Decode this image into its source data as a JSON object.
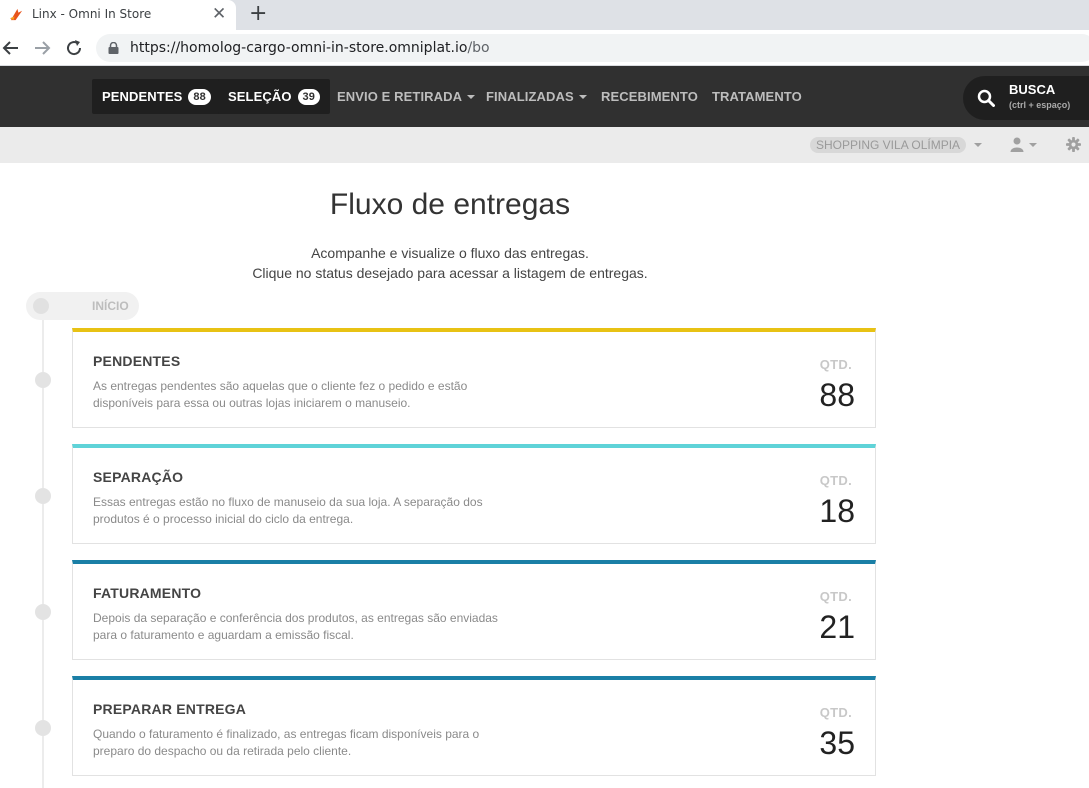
{
  "browser": {
    "tab_title": "Linx - Omni In Store",
    "tab_close": "✕",
    "new_tab": "+",
    "url_main": "https://homolog-cargo-omni-in-store.omniplat.io",
    "url_rest": "/bo"
  },
  "nav": {
    "items": [
      {
        "label": "PENDENTES",
        "badge": "88"
      },
      {
        "label": "SELEÇÃO",
        "badge": "39"
      },
      {
        "label": "ENVIO E RETIRADA"
      },
      {
        "label": "FINALIZADAS"
      },
      {
        "label": "RECEBIMENTO"
      },
      {
        "label": "TRATAMENTO"
      }
    ],
    "search_label": "BUSCA",
    "search_hint": "(ctrl + espaço)"
  },
  "subbar": {
    "store": "SHOPPING VILA OLÍMPIA"
  },
  "page": {
    "title": "Fluxo de entregas",
    "intro_line1": "Acompanhe e visualize o fluxo das entregas.",
    "intro_line2": "Clique no status desejado para acessar a listagem de entregas.",
    "start_label": "INÍCIO"
  },
  "cards": [
    {
      "title": "PENDENTES",
      "desc": "As entregas pendentes são aquelas que o cliente fez o pedido e estão disponíveis para essa ou outras lojas iniciarem o manuseio.",
      "qty_label": "QTD.",
      "qty": "88",
      "color": "#e8c214"
    },
    {
      "title": "SEPARAÇÃO",
      "desc": "Essas entregas estão no fluxo de manuseio da sua loja. A separação dos produtos é o processo inicial do ciclo da entrega.",
      "qty_label": "QTD.",
      "qty": "18",
      "color": "#5fd3d8"
    },
    {
      "title": "FATURAMENTO",
      "desc": "Depois da separação e conferência dos produtos, as entregas são enviadas para o faturamento e aguardam a emissão fiscal.",
      "qty_label": "QTD.",
      "qty": "21",
      "color": "#1a7fa6"
    },
    {
      "title": "PREPARAR ENTREGA",
      "desc": "Quando o faturamento é finalizado, as entregas ficam disponíveis para o preparo do despacho ou da retirada pelo cliente.",
      "qty_label": "QTD.",
      "qty": "35",
      "color": "#1a7fa6"
    }
  ]
}
